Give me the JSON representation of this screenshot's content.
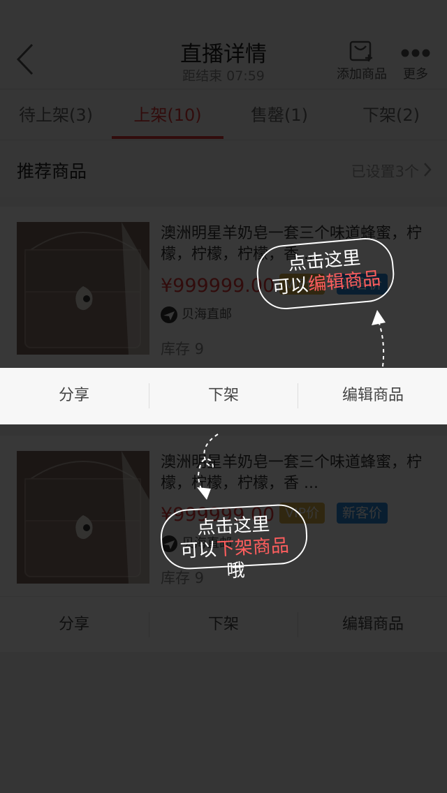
{
  "nav": {
    "title": "直播详情",
    "countdown": "距结束 07:59",
    "add_goods_label": "添加商品",
    "more_label": "更多"
  },
  "tabs": [
    {
      "label": "待上架(3)",
      "active": false
    },
    {
      "label": "上架(10)",
      "active": true
    },
    {
      "label": "售罄(1)",
      "active": false
    },
    {
      "label": "下架(2)",
      "active": false
    }
  ],
  "recommend": {
    "title": "推荐商品",
    "status": "已设置3个"
  },
  "products": [
    {
      "title": "澳洲明星羊奶皂一套三个味道蜂蜜，柠檬，柠檬，柠檬，香 ...",
      "price": "¥999999.00",
      "vip_badge": "VIP价",
      "new_badge": "新客价",
      "shipper": "贝海直邮",
      "stock": "库存 9"
    },
    {
      "title": "澳洲明星羊奶皂一套三个味道蜂蜜，柠檬，柠檬，柠檬，香 ...",
      "price": "¥999999.00",
      "vip_badge": "VIP价",
      "new_badge": "新客价",
      "shipper": "贝海直邮",
      "stock": "库存 9"
    }
  ],
  "actions": {
    "share": "分享",
    "delist": "下架",
    "edit": "编辑商品"
  },
  "tips": {
    "edit": {
      "line1": "点击这里",
      "prefix": "可以",
      "highlight": "编辑商品",
      "suffix": ""
    },
    "delist": {
      "line1": "点击这里",
      "prefix": "可以",
      "highlight": "下架商品",
      "suffix": "哦"
    }
  },
  "colors": {
    "accent": "#e03a3a",
    "vip": "#d8b34a",
    "new_customer": "#2c8ad8",
    "overlay": "rgba(0,0,0,0.78)"
  }
}
